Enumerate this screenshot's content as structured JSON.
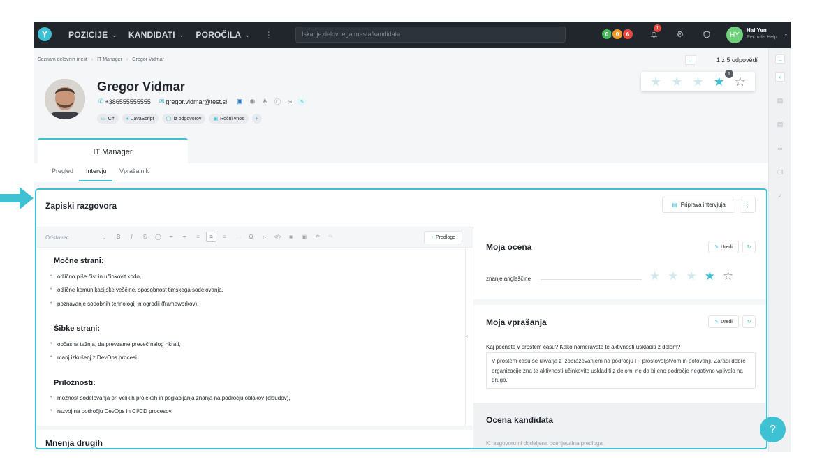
{
  "topbar": {
    "nav": [
      {
        "label": "POZICIJE",
        "has_chevron": true
      },
      {
        "label": "KANDIDATI",
        "has_chevron": true
      },
      {
        "label": "POROČILA",
        "has_chevron": true
      }
    ],
    "search_placeholder": "Iskanje delovnega mesta/kandidata",
    "status_pills": [
      "0",
      "0",
      "6"
    ],
    "status_colors": [
      "#47b65a",
      "#f39a2c",
      "#e6493e"
    ],
    "notification_count": "1",
    "user_initials": "HY",
    "user_name": "Hai Yen",
    "user_org": "Recruitis Help"
  },
  "breadcrumb": [
    "Seznam delovnih mest",
    "IT Manager",
    "Gregor Vidmar"
  ],
  "pager": "1 z 5 odpovědí",
  "candidate": {
    "name": "Gregor Vidmar",
    "phone": "+386555555555",
    "email": "gregor.vidmar@test.si",
    "socials": [
      "linkedin-icon",
      "facebook-icon",
      "twitter-icon",
      "skype-icon",
      "link-icon"
    ],
    "tags": [
      {
        "label": "C#",
        "icon": "monitor-icon"
      },
      {
        "label": "JavaScript",
        "icon": "user-icon"
      },
      {
        "label": "Iz odgovorov",
        "icon": "chat-icon"
      },
      {
        "label": "Ročni vnos",
        "icon": "briefcase-icon"
      }
    ],
    "rating": {
      "value": 4,
      "max": 5,
      "count_badge": "1"
    }
  },
  "job_tab": "IT Manager",
  "subtabs": [
    "Pregled",
    "Intervju",
    "Vprašalnik"
  ],
  "active_subtab": "Intervju",
  "panel": {
    "title": "Zapiski razgovora",
    "prep_button": "Priprava intervjuja",
    "editor": {
      "paragraph_style": "Odstavec",
      "templates_button": "Predloge",
      "sections": [
        {
          "heading": "Močne strani:",
          "items": [
            "odlično piše čist in učinkovit kodo,",
            "odlične komunikacijske veščine, sposobnost timskega sodelovanja,",
            "poznavanje sodobnih tehnologij in ogrodij (frameworkov)."
          ]
        },
        {
          "heading": "Šibke strani:",
          "items": [
            "občasna težnja, da prevzame preveč nalog hkrati,",
            "manj izkušenj z DevOps procesi."
          ]
        },
        {
          "heading": "Priložnosti:",
          "items": [
            "možnost sodelovanja pri velikih projektih in poglabljanja znanja na področju oblakov (cloudov),",
            "razvoj na področju DevOps in CI/CD procesov."
          ]
        }
      ]
    },
    "others_title": "Mnenja drugih",
    "my_rating": {
      "title": "Moja ocena",
      "edit_button": "Uredi",
      "criterion": "znanje angleščine",
      "value": 4,
      "max": 5
    },
    "my_questions": {
      "title": "Moja vprašanja",
      "edit_button": "Uredi",
      "question": "Kaj počnete v prostem času? Kako nameravate te aktivnosti uskladiti z delom?",
      "answer": "V prostem času se ukvarja z izobraževanjem na področju IT, prostovoljstvom in potovanji. Zaradi dobre organizacije zna te aktivnosti učinkovito uskladiti z delom, ne da bi eno področje negativno vplivalo na drugo."
    },
    "candidate_rating": {
      "title": "Ocena kandidata",
      "note": "K razgovoru ni dodeljena ocenjevalna predloga."
    }
  },
  "help_button": "?",
  "colors": {
    "accent": "#3ec1d3",
    "topbar": "#21262d"
  }
}
